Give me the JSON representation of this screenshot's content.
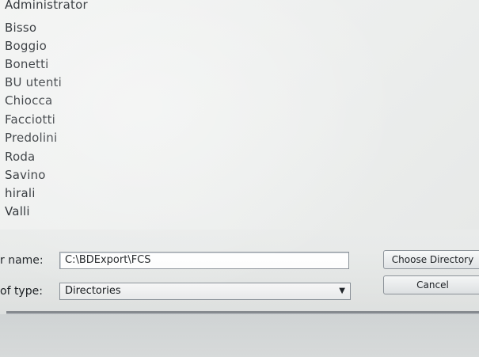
{
  "directory_list": {
    "items": [
      "Administrator",
      "Bisso",
      "Boggio",
      "Bonetti",
      "BU utenti",
      "Chiocca",
      "Facciotti",
      "Predolini",
      "Roda",
      "Savino",
      "hirali",
      "Valli"
    ]
  },
  "file_name": {
    "label": "r name:",
    "value": "C:\\BDExport\\FCS"
  },
  "file_type": {
    "label": "of type:",
    "selected": "Directories",
    "arrow_icon": "dropdown-arrow-icon"
  },
  "buttons": {
    "choose": "Choose Directory",
    "cancel": "Cancel"
  }
}
